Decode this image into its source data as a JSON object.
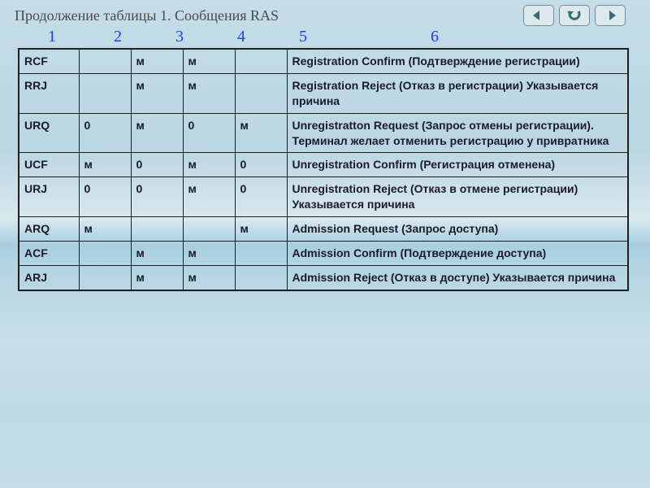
{
  "title": "Продолжение таблицы 1. Сообщения RAS",
  "columns": [
    "1",
    "2",
    "3",
    "4",
    "5",
    "6"
  ],
  "nav": {
    "back": "back",
    "undo": "undo",
    "forward": "forward"
  },
  "rows": [
    {
      "code": "RCF",
      "c2": "",
      "c3": "м",
      "c4": "м",
      "c5": "",
      "desc": "Registration Confirm (Подтверждение регистрации)"
    },
    {
      "code": "RRJ",
      "c2": "",
      "c3": "м",
      "c4": "м",
      "c5": "",
      "desc": "Registration Reject (Отказ в регистрации) Указывается причина"
    },
    {
      "code": "URQ",
      "c2": "0",
      "c3": "м",
      "c4": "0",
      "c5": "м",
      "desc": "Unregistratton Request (Запрос отмены регистрации). Терминал желает отменить регистрацию у привратника"
    },
    {
      "code": "UCF",
      "c2": "м",
      "c3": "0",
      "c4": "м",
      "c5": "0",
      "desc": "Unregistration Confirm (Регистрация отменена)"
    },
    {
      "code": "URJ",
      "c2": "0",
      "c3": "0",
      "c4": "м",
      "c5": "0",
      "desc": "Unregistration Reject (Отказ в отмене регистрации) Указывается причина"
    },
    {
      "code": "ARQ",
      "c2": "м",
      "c3": "",
      "c4": "",
      "c5": "м",
      "desc": "Admission Request (Запрос доступа)"
    },
    {
      "code": "ACF",
      "c2": "",
      "c3": "м",
      "c4": "м",
      "c5": "",
      "desc": "Admission Confirm (Подтверждение доступа)"
    },
    {
      "code": "ARJ",
      "c2": "",
      "c3": "м",
      "c4": "м",
      "c5": "",
      "desc": "Admission Reject (Отказ в доступе) Указывается причина"
    }
  ]
}
